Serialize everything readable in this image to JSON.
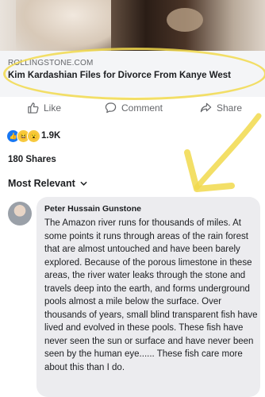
{
  "post": {
    "link_source": "ROLLINGSTONE.COM",
    "link_headline": "Kim Kardashian Files for Divorce From Kanye West"
  },
  "actions": {
    "like_label": "Like",
    "comment_label": "Comment",
    "share_label": "Share"
  },
  "reactions": {
    "icons": [
      "like-icon",
      "haha-icon",
      "wow-icon"
    ],
    "count": "1.9K"
  },
  "shares": {
    "label": "180 Shares"
  },
  "comments": {
    "sort_label": "Most Relevant",
    "items": [
      {
        "author": "Peter Hussain Gunstone",
        "text": "The Amazon river runs for thousands of miles.  At some points it runs through areas of the rain forest that are almost untouched and have been barely explored.  Because of the porous limestone in these areas, the river water leaks through the stone and travels deep into the earth, and forms underground pools almost a mile below the surface.  Over thousands of years, small blind transparent fish have lived and evolved in these pools.  These fish have never seen the sun or surface and have never been seen by the human eye...... These fish care more about this than I do."
      }
    ]
  },
  "colors": {
    "highlight": "#f1d94c",
    "accent": "#1877f2"
  }
}
